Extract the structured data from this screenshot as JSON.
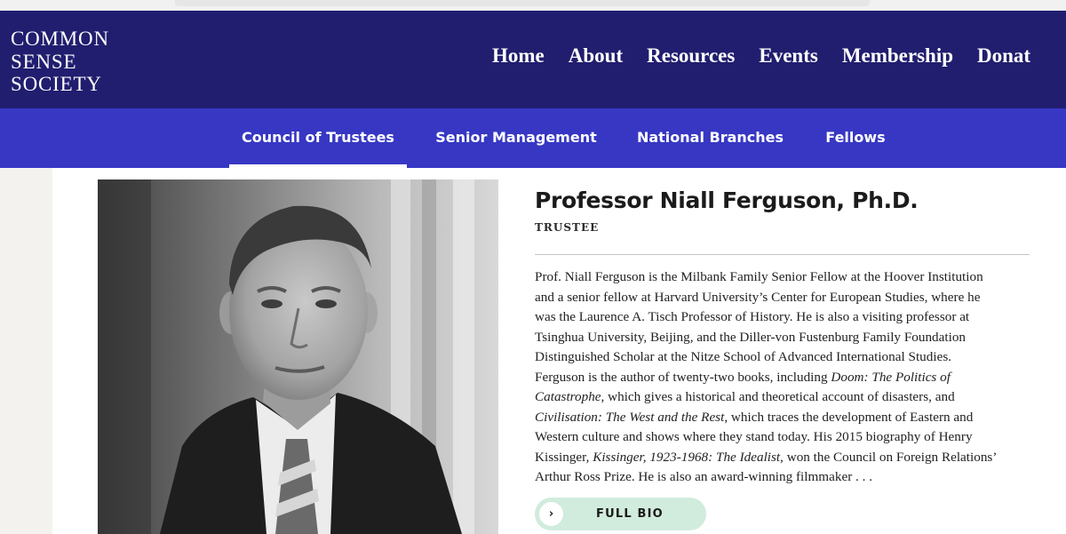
{
  "site": {
    "logo_lines": [
      "COMMON",
      "SENSE",
      "SOCIETY"
    ]
  },
  "main_nav": [
    "Home",
    "About",
    "Resources",
    "Events",
    "Membership",
    "Donat"
  ],
  "sub_nav": {
    "items": [
      "Council of Trustees",
      "Senior Management",
      "National Branches",
      "Fellows"
    ],
    "active": "Council of Trustees"
  },
  "profile": {
    "name": "Professor Niall Ferguson, Ph.D.",
    "role": "TRUSTEE",
    "photo_icon": "portrait-photo",
    "bio_lines": [
      [
        {
          "t": "Prof. Niall Ferguson is the Milbank Family Senior Fellow at the Hoover Institution"
        }
      ],
      [
        {
          "t": "and a senior fellow at Harvard University’s Center for European Studies, where he"
        }
      ],
      [
        {
          "t": "was the Laurence A. Tisch Professor of History. He is also a visiting professor at"
        }
      ],
      [
        {
          "t": "Tsinghua University, Beijing, and the Diller-von Fustenburg Family Foundation"
        }
      ],
      [
        {
          "t": "Distinguished Scholar at the Nitze School of Advanced International Studies."
        }
      ],
      [
        {
          "t": "Ferguson is the author of twenty-two books, including "
        },
        {
          "t": "Doom: The Politics of",
          "i": true
        }
      ],
      [
        {
          "t": "Catastrophe",
          "i": true
        },
        {
          "t": ", which gives a historical and theoretical account of disasters, and"
        }
      ],
      [
        {
          "t": "Civilisation: The West and the Rest",
          "i": true
        },
        {
          "t": ", which traces the development of Eastern and"
        }
      ],
      [
        {
          "t": "Western culture and shows where they stand today. His 2015 biography of Henry"
        }
      ],
      [
        {
          "t": "Kissinger, "
        },
        {
          "t": "Kissinger, 1923-1968: The Idealist",
          "i": true
        },
        {
          "t": ", won the Council on Foreign Relations’"
        }
      ],
      [
        {
          "t": "Arthur Ross Prize. He is also an award-winning filmmaker . . ."
        }
      ]
    ],
    "button": {
      "label": "FULL BIO",
      "icon": "chevron-right-icon",
      "icon_glyph": "›"
    }
  },
  "colors": {
    "header_bg": "#211e6f",
    "subnav_bg": "#3737c4",
    "button_bg": "#d1ebdd"
  }
}
